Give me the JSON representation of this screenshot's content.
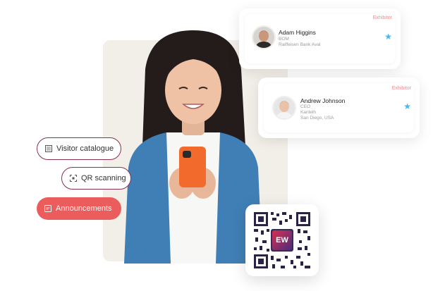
{
  "cards": [
    {
      "tag": "Exhibitor",
      "name": "Adam Higgins",
      "lines": [
        "BOM",
        "Raiffeisen Bank Aval"
      ],
      "starred": true
    },
    {
      "tag": "Exhibitor",
      "name": "Andrew Johnson",
      "lines": [
        "CEO",
        "Kantelh",
        "San Diego, USA"
      ],
      "starred": true
    }
  ],
  "pills": [
    {
      "label": "Visitor catalogue",
      "icon": "catalogue-icon"
    },
    {
      "label": "QR scanning",
      "icon": "qr-scan-icon"
    },
    {
      "label": "Announcements",
      "icon": "announcement-icon"
    }
  ],
  "qr": {
    "logo": "EW"
  },
  "colors": {
    "accent": "#eb5c5c",
    "pill_border": "#8c2f52",
    "star": "#45b6f0",
    "panel": "#f1efe7"
  }
}
